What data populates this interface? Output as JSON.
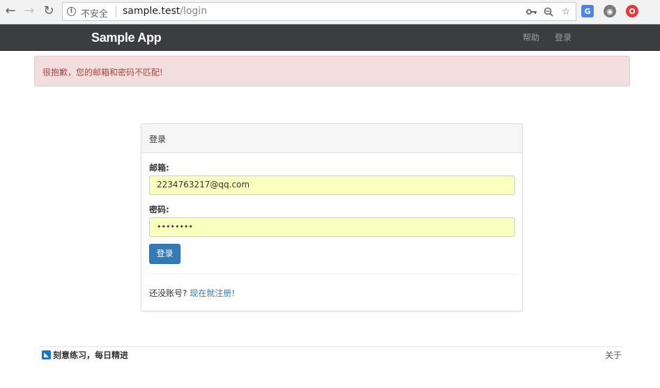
{
  "browser": {
    "security_label": "不安全",
    "url_host": "sample.test",
    "url_path": "/login"
  },
  "navbar": {
    "brand": "Sample App",
    "links": [
      {
        "label": "帮助"
      },
      {
        "label": "登录"
      }
    ]
  },
  "alert": {
    "message": "很抱歉，您的邮箱和密码不匹配!",
    "background_color": "#f2dede",
    "text_color": "#a94442"
  },
  "login_panel": {
    "heading": "登录",
    "email_label": "邮箱:",
    "email_value": "2234763217@qq.com",
    "password_label": "密码:",
    "password_value": "••••••••",
    "submit_label": "登录",
    "signup_prompt": "还没账号?",
    "signup_link": "现在就注册!",
    "accent_color": "#337ab7",
    "autofill_color": "#faffbd"
  },
  "footer": {
    "left_text": "刻意练习，每日精进",
    "right_link": "关于"
  }
}
